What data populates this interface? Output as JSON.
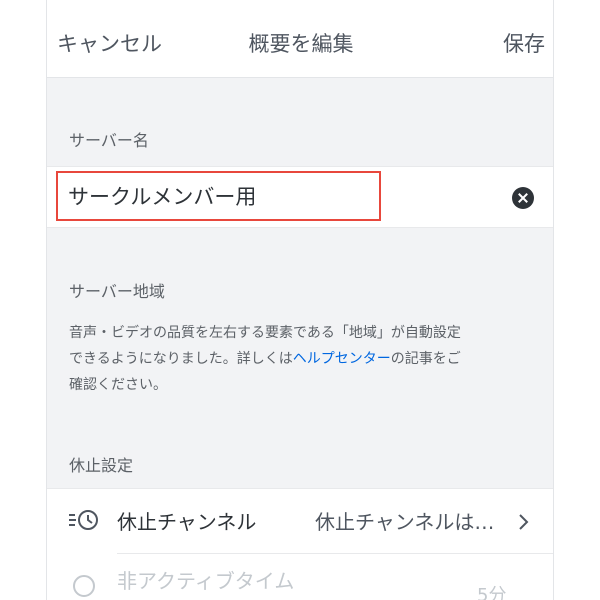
{
  "nav": {
    "cancel": "キャンセル",
    "title": "概要を編集",
    "save": "保存"
  },
  "server_name": {
    "label": "サーバー名",
    "value": "サークルメンバー用"
  },
  "region": {
    "label": "サーバー地域",
    "desc_line1": "音声・ビデオの品質を左右する要素である「地域」が自動設定",
    "desc_line2_before": "できるようになりました。詳しくは",
    "desc_link": "ヘルプセンター",
    "desc_line2_after": "の記事をご",
    "desc_line3": "確認ください。"
  },
  "afk": {
    "label": "休止設定",
    "channel_label": "休止チャンネル",
    "channel_value": "休止チャンネルは…",
    "timeout_label": "非アクティブタイム",
    "timeout_value": "5分"
  },
  "colors": {
    "highlight": "#e8473c",
    "link": "#0067e0",
    "background": "#f2f3f5"
  }
}
